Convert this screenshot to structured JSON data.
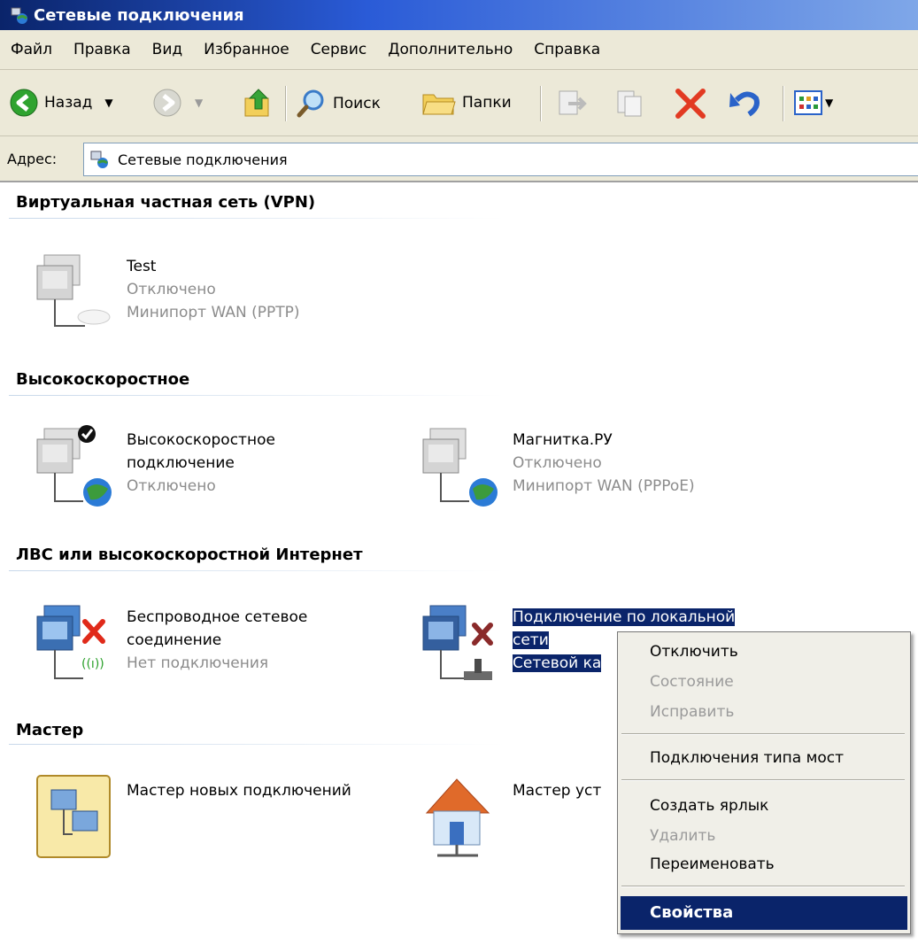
{
  "window": {
    "title": "Сетевые подключения"
  },
  "menu": [
    "Файл",
    "Правка",
    "Вид",
    "Избранное",
    "Сервис",
    "Дополнительно",
    "Справка"
  ],
  "toolbar": {
    "back_label": "Назад",
    "search_label": "Поиск",
    "folders_label": "Папки"
  },
  "address": {
    "label": "Адрес:",
    "value": "Сетевые подключения"
  },
  "groups": [
    {
      "title": "Виртуальная частная сеть (VPN)",
      "items": [
        {
          "lines": [
            "Test",
            "Отключено",
            "Минипорт WAN (PPTP)"
          ],
          "icon": "vpn-connection-icon"
        }
      ]
    },
    {
      "title": "Высокоскоростное",
      "items": [
        {
          "lines": [
            "Высокоскоростное",
            "подключение",
            "Отключено"
          ],
          "icon": "broadband-connection-icon"
        },
        {
          "lines": [
            "Магнитка.РУ",
            "Отключено",
            "Минипорт WAN (PPPoE)"
          ],
          "icon": "broadband-connection-icon"
        }
      ]
    },
    {
      "title": "ЛВС или высокоскоростной Интернет",
      "items": [
        {
          "lines": [
            "Беспроводное сетевое",
            "соединение",
            "Нет подключения"
          ],
          "icon": "wireless-connection-icon"
        },
        {
          "lines": [
            "Подключение по локальной",
            "сети",
            "Сетевой ка"
          ],
          "icon": "lan-connection-icon",
          "selected": true
        }
      ]
    },
    {
      "title": "Мастер",
      "items": [
        {
          "lines": [
            "Мастер новых подключений"
          ],
          "icon": "new-connection-wizard-icon"
        },
        {
          "lines": [
            "Мастер уст"
          ],
          "icon": "home-network-wizard-icon"
        }
      ]
    }
  ],
  "context_menu": {
    "items": [
      {
        "label": "Отключить",
        "enabled": true
      },
      {
        "label": "Состояние",
        "enabled": false
      },
      {
        "label": "Исправить",
        "enabled": false
      },
      {
        "label": "Подключения типа мост",
        "enabled": true
      },
      {
        "label": "Создать ярлык",
        "enabled": true
      },
      {
        "label": "Удалить",
        "enabled": false
      },
      {
        "label": "Переименовать",
        "enabled": true
      },
      {
        "label": "Свойства",
        "enabled": true,
        "highlighted": true
      }
    ]
  },
  "colors": {
    "selection": "#0a246a",
    "chrome": "#ece9d8",
    "disabled_text": "#8c8c8c"
  }
}
